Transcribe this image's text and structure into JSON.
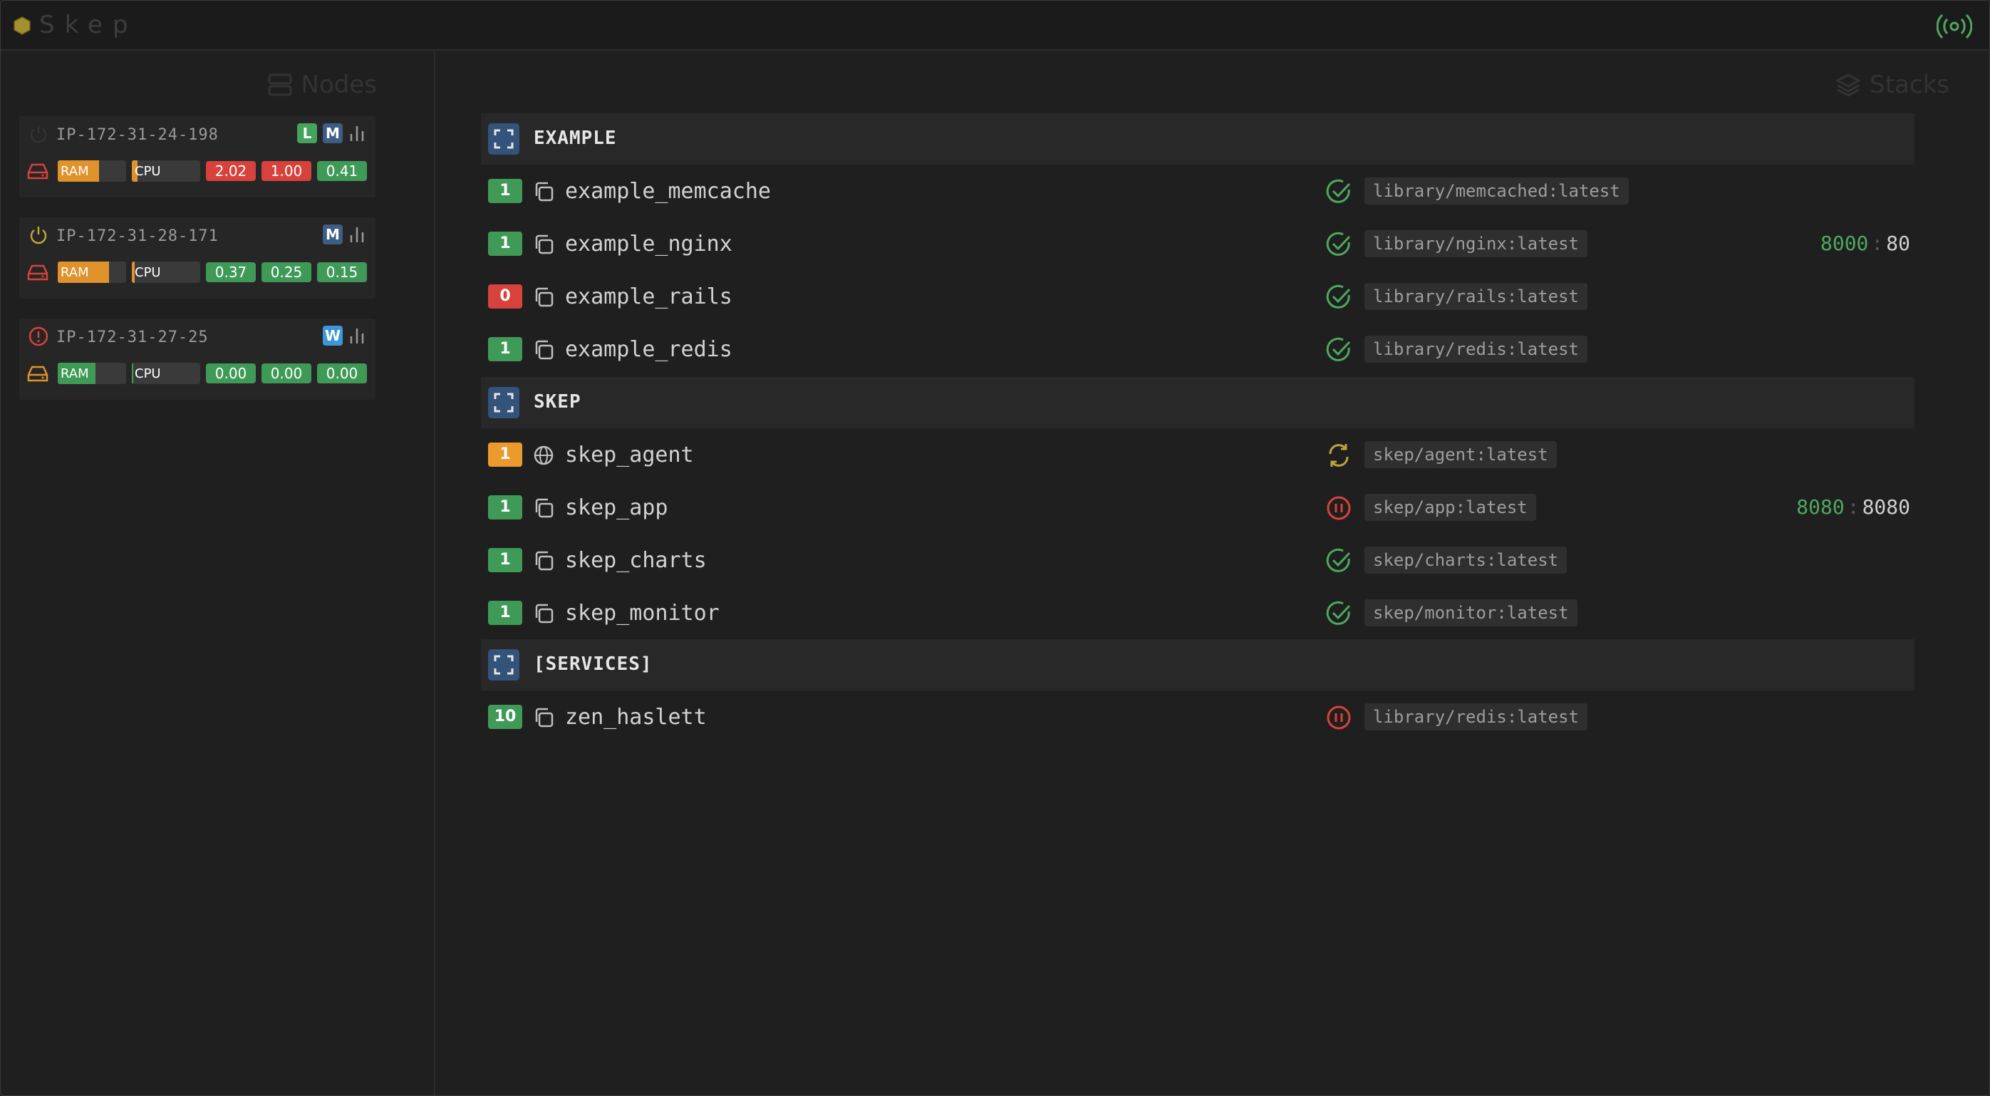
{
  "app": {
    "title": "Skep"
  },
  "nodes_panel": {
    "title": "Nodes",
    "nodes": [
      {
        "hostname": "IP-172-31-24-198",
        "status": "online",
        "roles": [
          "L",
          "M"
        ],
        "ram_percent": 60,
        "cpu_percent": 8,
        "load": [
          "2.02",
          "1.00",
          "0.41"
        ],
        "load_colors": [
          "red",
          "red",
          "green"
        ]
      },
      {
        "hostname": "IP-172-31-28-171",
        "status": "power",
        "roles": [
          "M"
        ],
        "ram_percent": 75,
        "cpu_percent": 4,
        "load": [
          "0.37",
          "0.25",
          "0.15"
        ],
        "load_colors": [
          "green",
          "green",
          "green"
        ]
      },
      {
        "hostname": "IP-172-31-27-25",
        "status": "error",
        "roles": [
          "W"
        ],
        "ram_percent": 55,
        "cpu_percent": 2,
        "load": [
          "0.00",
          "0.00",
          "0.00"
        ],
        "load_colors": [
          "green",
          "green",
          "green"
        ]
      }
    ],
    "ram_label": "RAM",
    "cpu_label": "CPU"
  },
  "stacks_panel": {
    "title": "Stacks",
    "stacks": [
      {
        "name": "EXAMPLE",
        "services": [
          {
            "count": "1",
            "count_color": "green",
            "mode": "replicated",
            "name": "example_memcache",
            "state": "ok",
            "image": "library/memcached:latest",
            "ports": null
          },
          {
            "count": "1",
            "count_color": "green",
            "mode": "replicated",
            "name": "example_nginx",
            "state": "ok",
            "image": "library/nginx:latest",
            "ports": {
              "published": "8000",
              "target": "80"
            }
          },
          {
            "count": "0",
            "count_color": "red",
            "mode": "replicated",
            "name": "example_rails",
            "state": "ok",
            "image": "library/rails:latest",
            "ports": null
          },
          {
            "count": "1",
            "count_color": "green",
            "mode": "replicated",
            "name": "example_redis",
            "state": "ok",
            "image": "library/redis:latest",
            "ports": null
          }
        ]
      },
      {
        "name": "SKEP",
        "services": [
          {
            "count": "1",
            "count_color": "orange",
            "mode": "global",
            "name": "skep_agent",
            "state": "updating",
            "image": "skep/agent:latest",
            "ports": null
          },
          {
            "count": "1",
            "count_color": "green",
            "mode": "replicated",
            "name": "skep_app",
            "state": "paused",
            "image": "skep/app:latest",
            "ports": {
              "published": "8080",
              "target": "8080"
            }
          },
          {
            "count": "1",
            "count_color": "green",
            "mode": "replicated",
            "name": "skep_charts",
            "state": "ok",
            "image": "skep/charts:latest",
            "ports": null
          },
          {
            "count": "1",
            "count_color": "green",
            "mode": "replicated",
            "name": "skep_monitor",
            "state": "ok",
            "image": "skep/monitor:latest",
            "ports": null
          }
        ]
      },
      {
        "name": "[SERVICES]",
        "services": [
          {
            "count": "10",
            "count_color": "green",
            "mode": "replicated",
            "name": "zen_haslett",
            "state": "paused",
            "image": "library/redis:latest",
            "ports": null
          }
        ]
      }
    ]
  },
  "colors": {
    "ok": "#4da85f",
    "paused": "#d8423c",
    "updating": "#bca53a",
    "role_leader": "#44a35c",
    "role_manager": "#3d5d85",
    "role_worker": "#3b97d9"
  },
  "icons": {
    "logo": "hexagon-icon",
    "connection": "signal-icon",
    "nodes": "server-icon",
    "stacks": "layers-icon"
  }
}
